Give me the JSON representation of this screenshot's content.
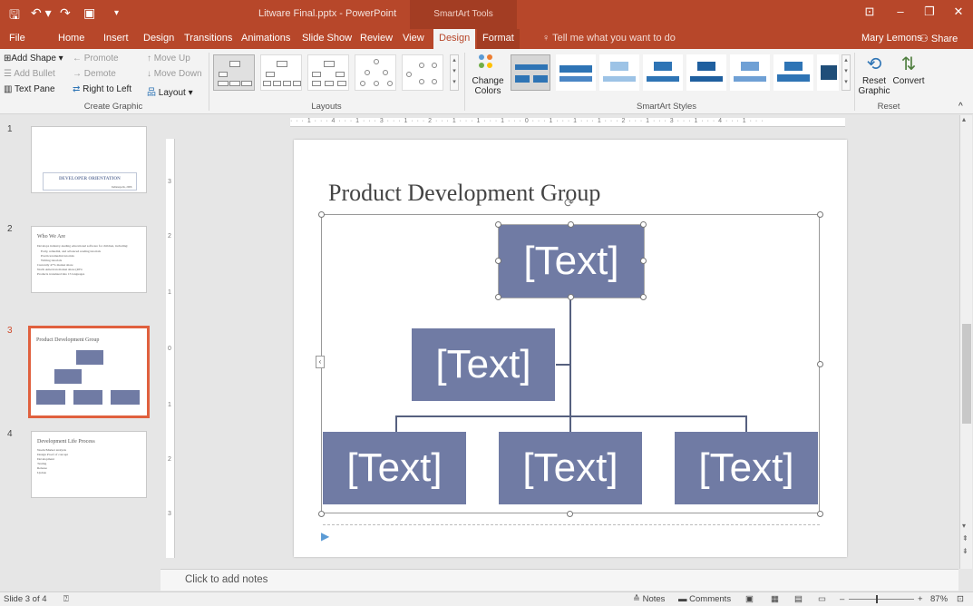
{
  "titlebar": {
    "doc_title": "Litware Final.pptx - PowerPoint",
    "context_title": "SmartArt Tools",
    "icons": [
      "save-icon",
      "undo-icon",
      "redo-icon",
      "start-from-beginning-icon",
      "customize-qat-icon"
    ],
    "window_icons": [
      "ribbon-display-options-icon",
      "minimize-icon",
      "restore-icon",
      "close-icon"
    ]
  },
  "tabs": [
    "File",
    "Home",
    "Insert",
    "Design",
    "Transitions",
    "Animations",
    "Slide Show",
    "Review",
    "View",
    "Design",
    "Format"
  ],
  "tellme": "Tell me what you want to do",
  "user": "Mary Lemons",
  "share": "Share",
  "ribbon": {
    "create_graphic": {
      "add_shape": "Add Shape",
      "add_bullet": "Add Bullet",
      "text_pane": "Text Pane",
      "promote": "Promote",
      "demote": "Demote",
      "right_to_left": "Right to Left",
      "move_up": "Move Up",
      "move_down": "Move Down",
      "layout": "Layout",
      "label": "Create Graphic"
    },
    "layouts_label": "Layouts",
    "change_colors": "Change Colors",
    "smartart_styles_label": "SmartArt Styles",
    "reset": {
      "reset_graphic": "Reset Graphic",
      "convert": "Convert",
      "label": "Reset"
    }
  },
  "slides": [
    {
      "number": "1",
      "title": "DEVELOPER ORIENTATION",
      "subtitle": "Indianapolis, 2006"
    },
    {
      "number": "2",
      "title": "Who We Are",
      "bullets": [
        "Develops industry-leading educational software for children, including:",
        "Early, remedial, and advanced reading tutorials",
        "Practice/remedial tutorials",
        "Writing tutorials",
        "Currently 47% market share",
        "North American market share (48%",
        "Products translated into 15 languages"
      ]
    },
    {
      "number": "3",
      "title": "Product Development Group"
    },
    {
      "number": "4",
      "title": "Development Life Process",
      "bullets": [
        "Needs/Market analysis",
        "Design Proof of concept",
        "Development",
        "Testing",
        "Release",
        "Update"
      ]
    }
  ],
  "slide": {
    "title": "Product Development Group",
    "boxes": [
      "[Text]",
      "[Text]",
      "[Text]",
      "[Text]",
      "[Text]"
    ]
  },
  "ruler": {
    "h": "· · · 1 · · · 4 · · · 1 · · · 3 · · · 1 · · · 2 · · · 1 · · · 1 · · · 1 · · · 0 · · · 1 · · · 1 · · · 1 · · · 2 · · · 1 · · · 3 · · · 1 · · · 4 · · · 1 · · ·",
    "v": [
      "3",
      "2",
      "1",
      "0",
      "1",
      "2",
      "3"
    ]
  },
  "notes_placeholder": "Click to add notes",
  "status": {
    "slide_info": "Slide 3 of 4",
    "notes": "Notes",
    "comments": "Comments",
    "zoom": "87%"
  }
}
